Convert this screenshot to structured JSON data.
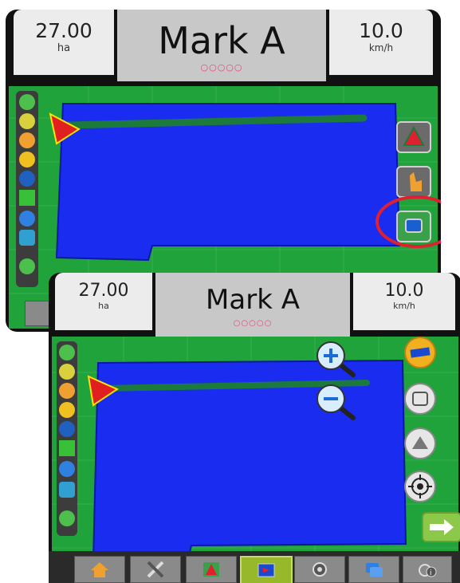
{
  "screen_top": {
    "area_value": "27.00",
    "area_unit": "ha",
    "title": "Mark A",
    "speed_value": "10.0",
    "speed_unit": "km/h",
    "pager_dots": "○○○○○"
  },
  "screen_bottom": {
    "area_value": "27.00",
    "area_unit": "ha",
    "title": "Mark A",
    "speed_value": "10.0",
    "speed_unit": "km/h",
    "pager_dots": "○○○○○"
  },
  "left_status_icons": [
    "implement-icon",
    "boom-icon",
    "tractor-icon",
    "target-icon",
    "tilt-icon",
    "gps-icon",
    "water-drop-icon",
    "sprayer-icon",
    "link-icon"
  ],
  "top_right_buttons": [
    "vehicle-view-button",
    "pan-mode-button",
    "field-view-button"
  ],
  "bottom_right_buttons": [
    "vehicle-orientation-toggle",
    "field-extents-button",
    "perspective-button",
    "center-vehicle-button"
  ],
  "zoom_controls": [
    "zoom-in-icon",
    "zoom-out-icon"
  ],
  "bottom_tabs": [
    "home-tab",
    "tools-tab",
    "guidance-tab",
    "field-map-tab",
    "camera-tab",
    "settings-tab",
    "info-tab"
  ],
  "active_tab": "field-map-tab",
  "colors": {
    "field_green": "#1fa33a",
    "boundary_blue": "#1a2cf0",
    "guideline_green": "#1b7a3c",
    "highlight_red": "#e02030"
  }
}
